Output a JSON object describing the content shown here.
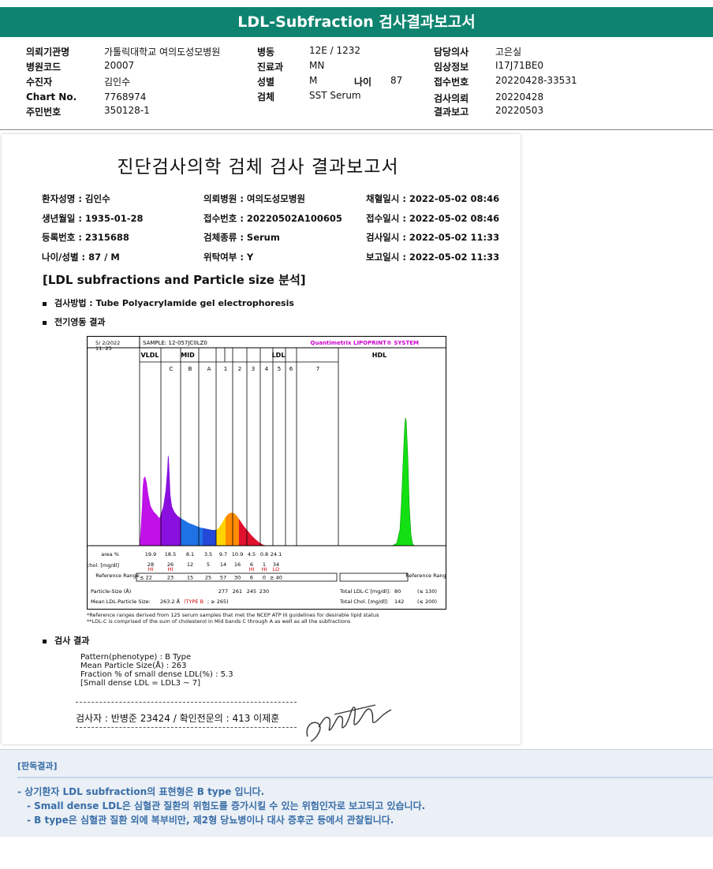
{
  "banner_title": "LDL-Subfraction 검사결과보고서",
  "header": [
    {
      "k": "의뢰기관명",
      "v": "가톨릭대학교 여의도성모병원"
    },
    {
      "k": "병원코드",
      "v": "20007"
    },
    {
      "k": "수진자",
      "v": "김인수"
    },
    {
      "k": "Chart No.",
      "v": "7768974"
    },
    {
      "k": "주민번호",
      "v": "350128-1"
    },
    {
      "k": "병동",
      "v": "12E / 1232"
    },
    {
      "k": "진료과",
      "v": "MN"
    },
    {
      "k": "성별",
      "v": "M"
    },
    {
      "k": "나이",
      "v": "87"
    },
    {
      "k": "검체",
      "v": "SST Serum"
    },
    {
      "k": "담당의사",
      "v": "고은실"
    },
    {
      "k": "임상정보",
      "v": "I17J71BE0"
    },
    {
      "k": "접수번호",
      "v": "20220428-33531"
    },
    {
      "k": "검사의뢰",
      "v": "20220428"
    },
    {
      "k": "결과보고",
      "v": "20220503"
    }
  ],
  "report": {
    "title": "진단검사의학 검체 검사 결과보고서",
    "fields": [
      "환자성명 : 김인수",
      "의뢰병원 : 여의도성모병원",
      "채혈일시 : 2022-05-02 08:46",
      "생년월일 : 1935-01-28",
      "접수번호 : 20220502A100605",
      "접수일시 : 2022-05-02 08:46",
      "등록번호 : 2315688",
      "검체종류 : Serum",
      "검사일시 : 2022-05-02 11:33",
      "나이/성별 : 87 / M",
      "위탁여부 : Y",
      "보고일시 : 2022-05-02 11:33"
    ],
    "section_title": "[LDL subfractions and Particle size 분석]",
    "method": "검사방법 : Tube Polyacrylamide gel electrophoresis",
    "electro_label": "전기영동 결과",
    "result_label": "검사 결과",
    "results": [
      "Pattern(phenotype) : B Type",
      "Mean Particle Size(Å) : 263",
      "Fraction % of small dense LDL(%) : 5.3",
      "[Small dense LDL = LDL3 ~ 7]"
    ],
    "signature": "검사자 : 반병준 23424  /  확인전문의 : 413 이제훈",
    "footnotes": [
      "*Reference ranges derived from 125 serum samples that met the NCEP ATP III guidelines for desirable lipid status",
      "**LDL-C is comprised of the sum of cholesterol in Mid bands C through A as well as all the subfractions"
    ]
  },
  "chart_data": {
    "type": "area",
    "date": "5/ 2/2022",
    "time": "11: 25",
    "sample": "SAMPLE:  12-057JC0LZ0",
    "system": "Quantimetrix LIPOPRINT® SYSTEM",
    "groups": [
      "VLDL",
      "MID",
      "LDL",
      "HDL"
    ],
    "bands": [
      "C",
      "B",
      "A",
      "1",
      "2",
      "3",
      "4",
      "5",
      "6",
      "7"
    ],
    "area_label": "area %",
    "area": [
      "19.9",
      "18.5",
      "8.1",
      "3.5",
      "9.7",
      "10.9",
      "4.5",
      "0.8",
      "24.1"
    ],
    "chol_label": "chol. [mg/dl]",
    "chol": [
      "28",
      "26",
      "12",
      "5",
      "14",
      "16",
      "6",
      "1",
      "34"
    ],
    "flags": [
      "HI",
      "HI",
      "",
      "",
      "",
      "",
      "HI",
      "HI",
      "LO"
    ],
    "ref_label": "Reference Range",
    "ref": [
      "≤ 22",
      "23",
      "15",
      "25",
      "57",
      "30",
      "6",
      "0",
      "≥ 40"
    ],
    "particle_label": "Particle-Size (Å)",
    "particle": [
      "277",
      "261",
      "245",
      "230"
    ],
    "mean_label": "Mean LDL-Particle Size:",
    "mean_value": "263.2 Å",
    "mean_type": "(TYPE B",
    "mean_ref": "; ≥ 265)",
    "total_ldl_label": "Total LDL-C [mg/dl]:",
    "total_ldl": "80",
    "total_ldl_ref": "(≤ 130)",
    "total_chol_label": "Total Chol. [mg/dl]:",
    "total_chol": "142",
    "total_chol_ref": "(≤ 200)"
  },
  "judgement": {
    "title": "[판독결과]",
    "lines": [
      "- 상기환자 LDL subfraction의 표현형은 B type 입니다.",
      "- Small dense LDL은 심혈관 질환의 위험도를 증가시킬 수 있는 위험인자로 보고되고 있습니다.",
      "- B type은 심혈관 질환 외에 복부비만, 제2형 당뇨병이나 대사 증후군 등에서 관찰됩니다."
    ]
  },
  "colors": {
    "banner": "#0e8470",
    "judgement_text": "#3a6ea8",
    "flag": "#cc0000",
    "system_label": "#cc00cc"
  }
}
